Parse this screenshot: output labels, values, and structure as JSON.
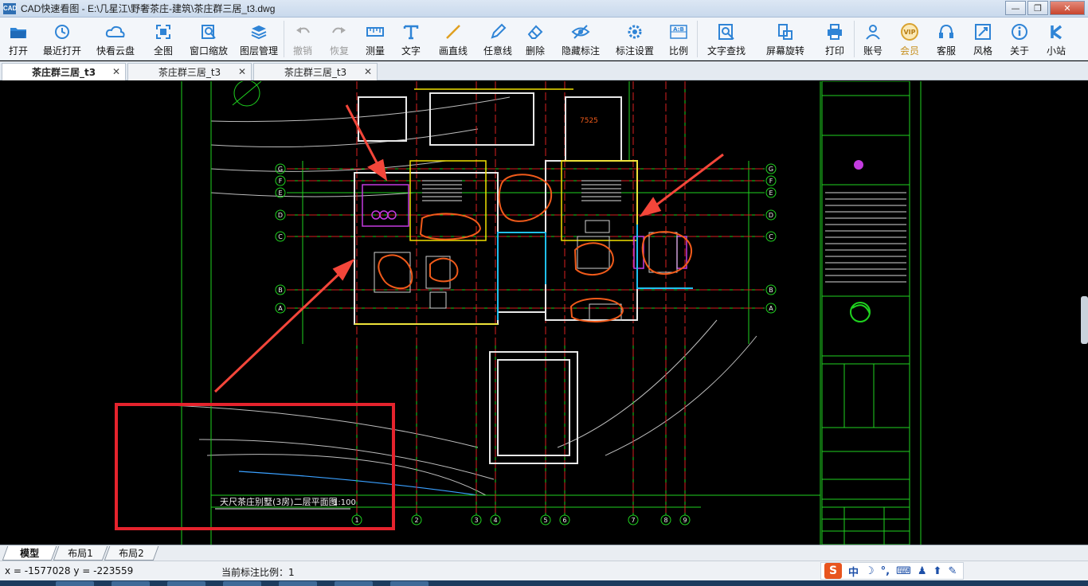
{
  "window": {
    "app_icon_text": "CAD",
    "title": "CAD快速看图 - E:\\几星江\\野奢茶庄-建筑\\茶庄群三居_t3.dwg",
    "minimize": "—",
    "maximize": "❐",
    "close": "✕"
  },
  "toolbar": [
    {
      "key": "open",
      "label": "打开",
      "icon": "folder-icon"
    },
    {
      "key": "recent",
      "label": "最近打开",
      "icon": "clock-icon"
    },
    {
      "key": "cloud",
      "label": "快看云盘",
      "icon": "cloud-icon"
    },
    {
      "key": "full",
      "label": "全图",
      "icon": "fullview-icon"
    },
    {
      "key": "window-zoom",
      "label": "窗口缩放",
      "icon": "zoom-window-icon"
    },
    {
      "key": "layers",
      "label": "图层管理",
      "icon": "layers-icon"
    },
    {
      "key": "undo",
      "label": "撤销",
      "icon": "undo-icon",
      "disabled": true
    },
    {
      "key": "redo",
      "label": "恢复",
      "icon": "redo-icon",
      "disabled": true
    },
    {
      "key": "measure",
      "label": "测量",
      "icon": "ruler-icon"
    },
    {
      "key": "text",
      "label": "文字",
      "icon": "text-icon"
    },
    {
      "key": "line",
      "label": "画直线",
      "icon": "line-icon"
    },
    {
      "key": "freeline",
      "label": "任意线",
      "icon": "pen-icon"
    },
    {
      "key": "delete",
      "label": "删除",
      "icon": "eraser-icon"
    },
    {
      "key": "hide-marks",
      "label": "隐藏标注",
      "icon": "eye-icon"
    },
    {
      "key": "mark-settings",
      "label": "标注设置",
      "icon": "settings-icon"
    },
    {
      "key": "ratio",
      "label": "比例",
      "icon": "ratio-icon"
    },
    {
      "key": "text-search",
      "label": "文字查找",
      "icon": "search-text-icon"
    },
    {
      "key": "rotate",
      "label": "屏幕旋转",
      "icon": "rotate-icon"
    },
    {
      "key": "print",
      "label": "打印",
      "icon": "printer-icon"
    },
    {
      "key": "account",
      "label": "账号",
      "icon": "user-icon"
    },
    {
      "key": "vip",
      "label": "会员",
      "icon": "vip-icon",
      "vip": true,
      "badge": "VIP"
    },
    {
      "key": "support",
      "label": "客服",
      "icon": "headset-icon"
    },
    {
      "key": "style",
      "label": "风格",
      "icon": "style-icon"
    },
    {
      "key": "about",
      "label": "关于",
      "icon": "info-icon"
    },
    {
      "key": "site",
      "label": "小站",
      "icon": "k-icon"
    }
  ],
  "ratio_icon_text": "A:B",
  "doc_tabs": [
    {
      "label": "茶庄群三居_t3",
      "active": true
    },
    {
      "label": "茶庄群三居_t3",
      "active": false
    },
    {
      "label": "茶庄群三居_t3",
      "active": false
    }
  ],
  "tab_close": "✕",
  "drawing": {
    "title": "天尺茶庄别墅(3房)二层平面图",
    "scale": "1:100",
    "axis_left": [
      "G",
      "F",
      "E",
      "D",
      "C",
      "B",
      "A"
    ],
    "axis_right": [
      "G",
      "F",
      "E",
      "D",
      "C",
      "B",
      "A"
    ],
    "axis_bottom": [
      "1",
      "2",
      "3",
      "4",
      "5",
      "6",
      "7",
      "8",
      "9"
    ],
    "dimension_label": "7525",
    "colors": {
      "grid_green": "#1fd21f",
      "wall_white": "#e8e8e8",
      "axis_red": "#d82020",
      "annotation_orange": "#f05a1a",
      "arrow_red": "#f4463a",
      "rect_red": "#e5232d"
    }
  },
  "layout_tabs": [
    {
      "label": "模型",
      "active": true
    },
    {
      "label": "布局1",
      "active": false
    },
    {
      "label": "布局2",
      "active": false
    }
  ],
  "status": {
    "coords": "x = -1577028  y = -223559",
    "scale_text": "当前标注比例：1"
  },
  "ime": {
    "logo": "S",
    "lang": "中",
    "moon": "☽",
    "punct": "°,",
    "keyboard": "⌨",
    "user": "♟",
    "skin": "⬆",
    "tools": "✎"
  }
}
